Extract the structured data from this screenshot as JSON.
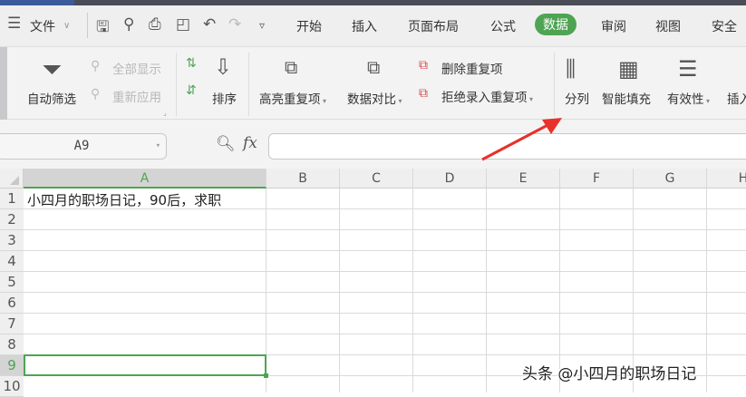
{
  "menubar": {
    "file": "文件",
    "tabs": [
      "开始",
      "插入",
      "页面布局",
      "公式",
      "数据",
      "审阅",
      "视图",
      "安全"
    ],
    "active_tab": "数据"
  },
  "ribbon": {
    "auto_filter": "自动筛选",
    "show_all": "全部显示",
    "reapply": "重新应用",
    "sort": "排序",
    "highlight_dup": "高亮重复项",
    "compare": "数据对比",
    "remove_dup": "删除重复项",
    "reject_dup": "拒绝录入重复项",
    "split": "分列",
    "smart_fill": "智能填充",
    "validity": "有效性",
    "insert": "插入"
  },
  "formula_bar": {
    "name_box": "A9",
    "fx": "fx",
    "value": ""
  },
  "sheet": {
    "columns": [
      "A",
      "B",
      "C",
      "D",
      "E",
      "F",
      "G",
      "H"
    ],
    "rows": [
      "1",
      "2",
      "3",
      "4",
      "5",
      "6",
      "7",
      "8",
      "9",
      "10"
    ],
    "selected_cell": "A9",
    "A1": "小四月的职场日记，90后，求职"
  },
  "watermark": "头条 @小四月的职场日记",
  "colors": {
    "accent": "#4ea452",
    "arrow": "#e8312a"
  }
}
